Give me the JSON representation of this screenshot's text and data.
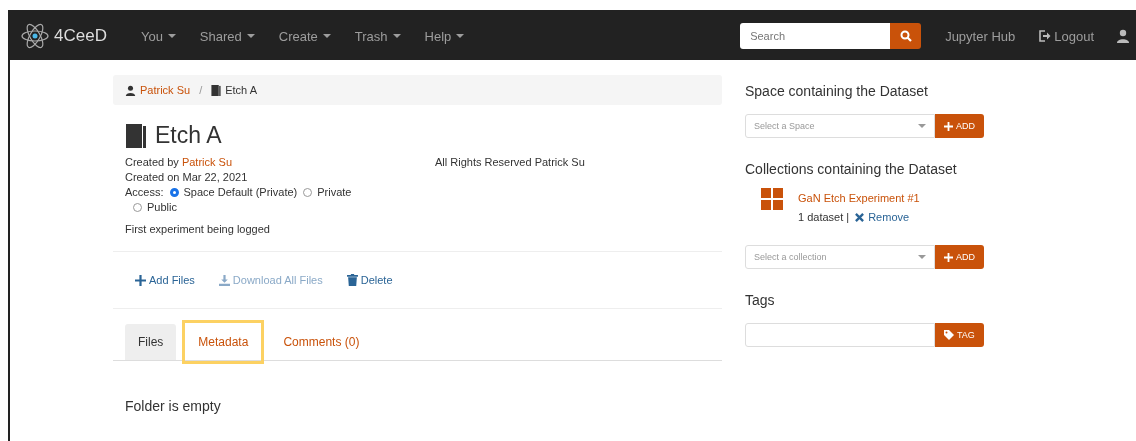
{
  "navbar": {
    "brand": "4CeeD",
    "menus": [
      {
        "label": "You"
      },
      {
        "label": "Shared"
      },
      {
        "label": "Create"
      },
      {
        "label": "Trash"
      },
      {
        "label": "Help"
      }
    ],
    "search": {
      "placeholder": "Search"
    },
    "links": [
      {
        "label": "Jupyter Hub",
        "kind": "plain"
      },
      {
        "label": "Logout",
        "kind": "logout"
      }
    ]
  },
  "breadcrumb_separator": "/",
  "breadcrumb": [
    {
      "label": "Patrick Su",
      "kind": "user"
    },
    {
      "label": "Etch A",
      "kind": "dataset"
    }
  ],
  "dataset": {
    "title": "Etch A",
    "created_by_label": "Created by",
    "creator": "Patrick Su",
    "created_on": "Created on Mar 22, 2021",
    "license": "All Rights Reserved Patrick Su",
    "access_label": "Access:",
    "access_options": [
      {
        "label": "Space Default (Private)",
        "selected": true
      },
      {
        "label": "Private",
        "selected": false
      },
      {
        "label": "Public",
        "selected": false
      }
    ],
    "description": "First experiment being logged"
  },
  "actions": [
    {
      "label": "Add Files",
      "kind": "add",
      "disabled": false
    },
    {
      "label": "Download All Files",
      "kind": "download",
      "disabled": true
    },
    {
      "label": "Delete",
      "kind": "delete",
      "disabled": false
    }
  ],
  "tabs": [
    {
      "label": "Files",
      "selected": true,
      "highlighted": false
    },
    {
      "label": "Metadata",
      "selected": false,
      "highlighted": true
    },
    {
      "label": "Comments (0)",
      "selected": false,
      "highlighted": false
    }
  ],
  "folder_message": "Folder is empty",
  "sidebar": {
    "space_heading": "Space containing the Dataset",
    "space_select": {
      "placeholder": "Select a Space"
    },
    "space_add": "ADD",
    "collections_heading": "Collections containing the Dataset",
    "collections": [
      {
        "name": "GaN Etch Experiment #1",
        "count": "1 dataset |",
        "remove": "Remove"
      }
    ],
    "collection_select": {
      "placeholder": "Select a collection"
    },
    "collection_add": "ADD",
    "tags_heading": "Tags",
    "tag_button": "TAG"
  }
}
